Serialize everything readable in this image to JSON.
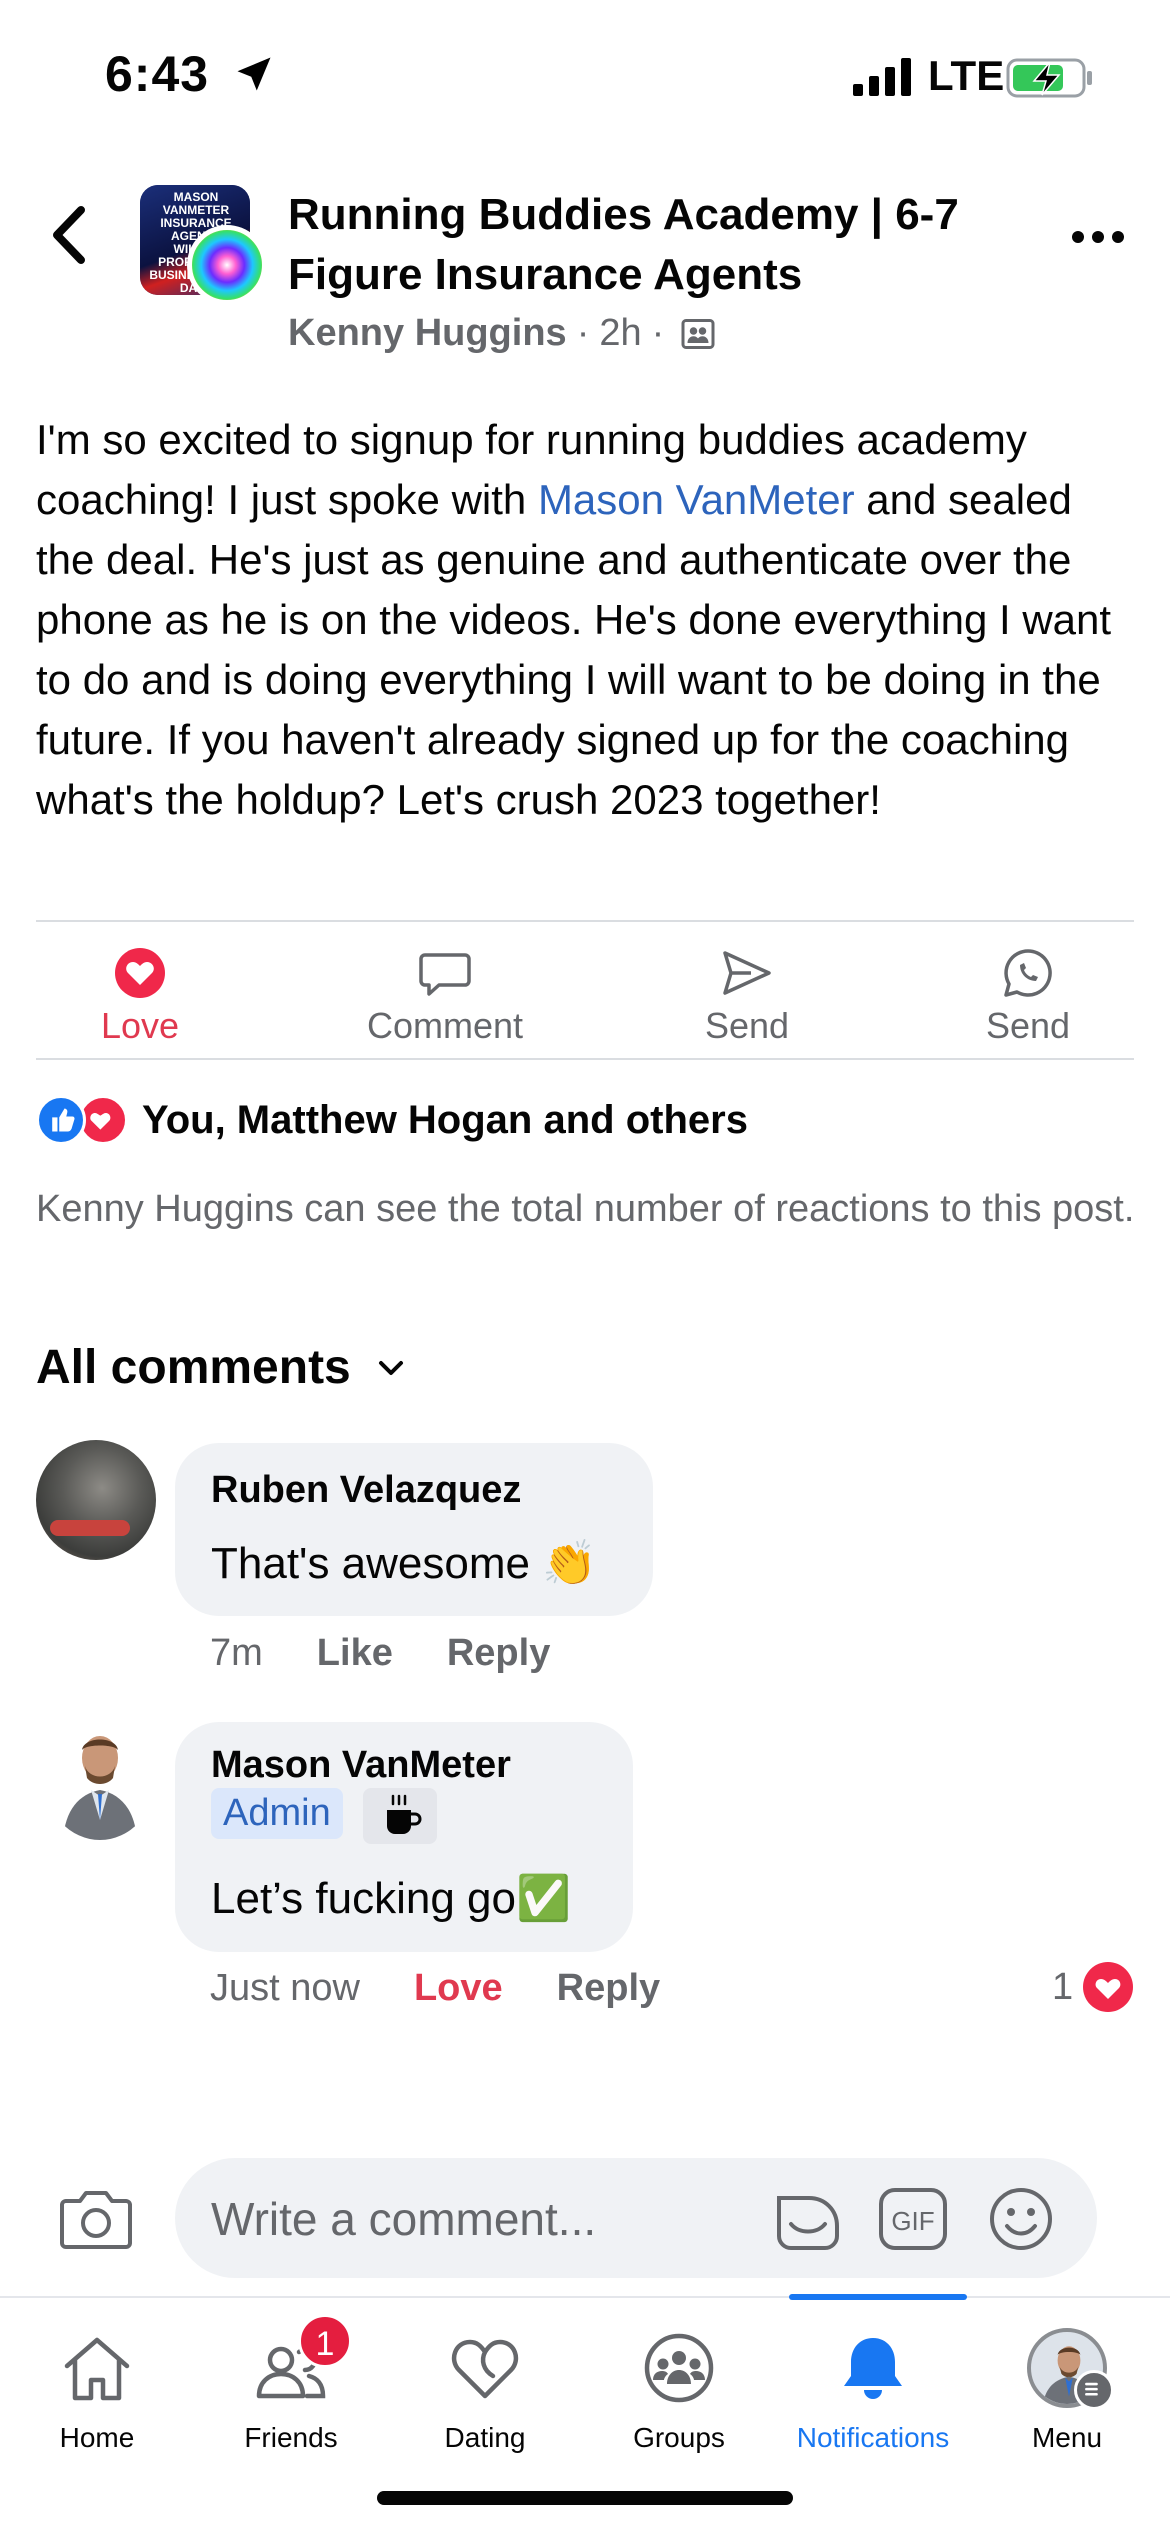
{
  "status_bar": {
    "time": "6:43",
    "network": "LTE"
  },
  "post": {
    "group_name": "Running Buddies Academy | 6-7 Figure Insurance Agents",
    "author": "Kenny Huggins",
    "time": "2h",
    "avatar_text": "MASON VANMETER INSURANCE AGENTS WILDLY PROFITABLE BUSINESS IN 90 DAYS",
    "body_before": "I'm so excited to signup for running buddies academy coaching! I just spoke with ",
    "mention": "Mason VanMeter",
    "body_after": " and sealed the deal. He's just as genuine and authenticate over the phone as he is on the videos. He's done everything I want to do and is doing everything I will want to be doing in the future. If you haven't already signed up for the coaching what's the holdup? Let's crush 2023 together!"
  },
  "actions": {
    "love": "Love",
    "comment": "Comment",
    "send": "Send",
    "send_whatsapp": "Send"
  },
  "reactions": {
    "summary": "You, Matthew Hogan and others",
    "note": "Kenny Huggins can see the total number of reactions to this post."
  },
  "comments_header": "All comments",
  "comments": [
    {
      "name": "Ruben Velazquez",
      "text": "That's awesome 👏",
      "time": "7m",
      "like": "Like",
      "reply": "Reply"
    },
    {
      "name": "Mason VanMeter",
      "badge": "Admin",
      "text": "Let’s fucking go✅",
      "time": "Just now",
      "love": "Love",
      "reply": "Reply",
      "reaction_count": "1"
    }
  ],
  "composer": {
    "placeholder": "Write a comment..."
  },
  "nav": {
    "home": "Home",
    "friends": "Friends",
    "friends_badge": "1",
    "dating": "Dating",
    "groups": "Groups",
    "notifications": "Notifications",
    "menu": "Menu"
  },
  "colors": {
    "accent_blue": "#1877f2",
    "love_red": "#e0394f",
    "mention_blue": "#2d64bc",
    "secondary_text": "#65676b"
  }
}
